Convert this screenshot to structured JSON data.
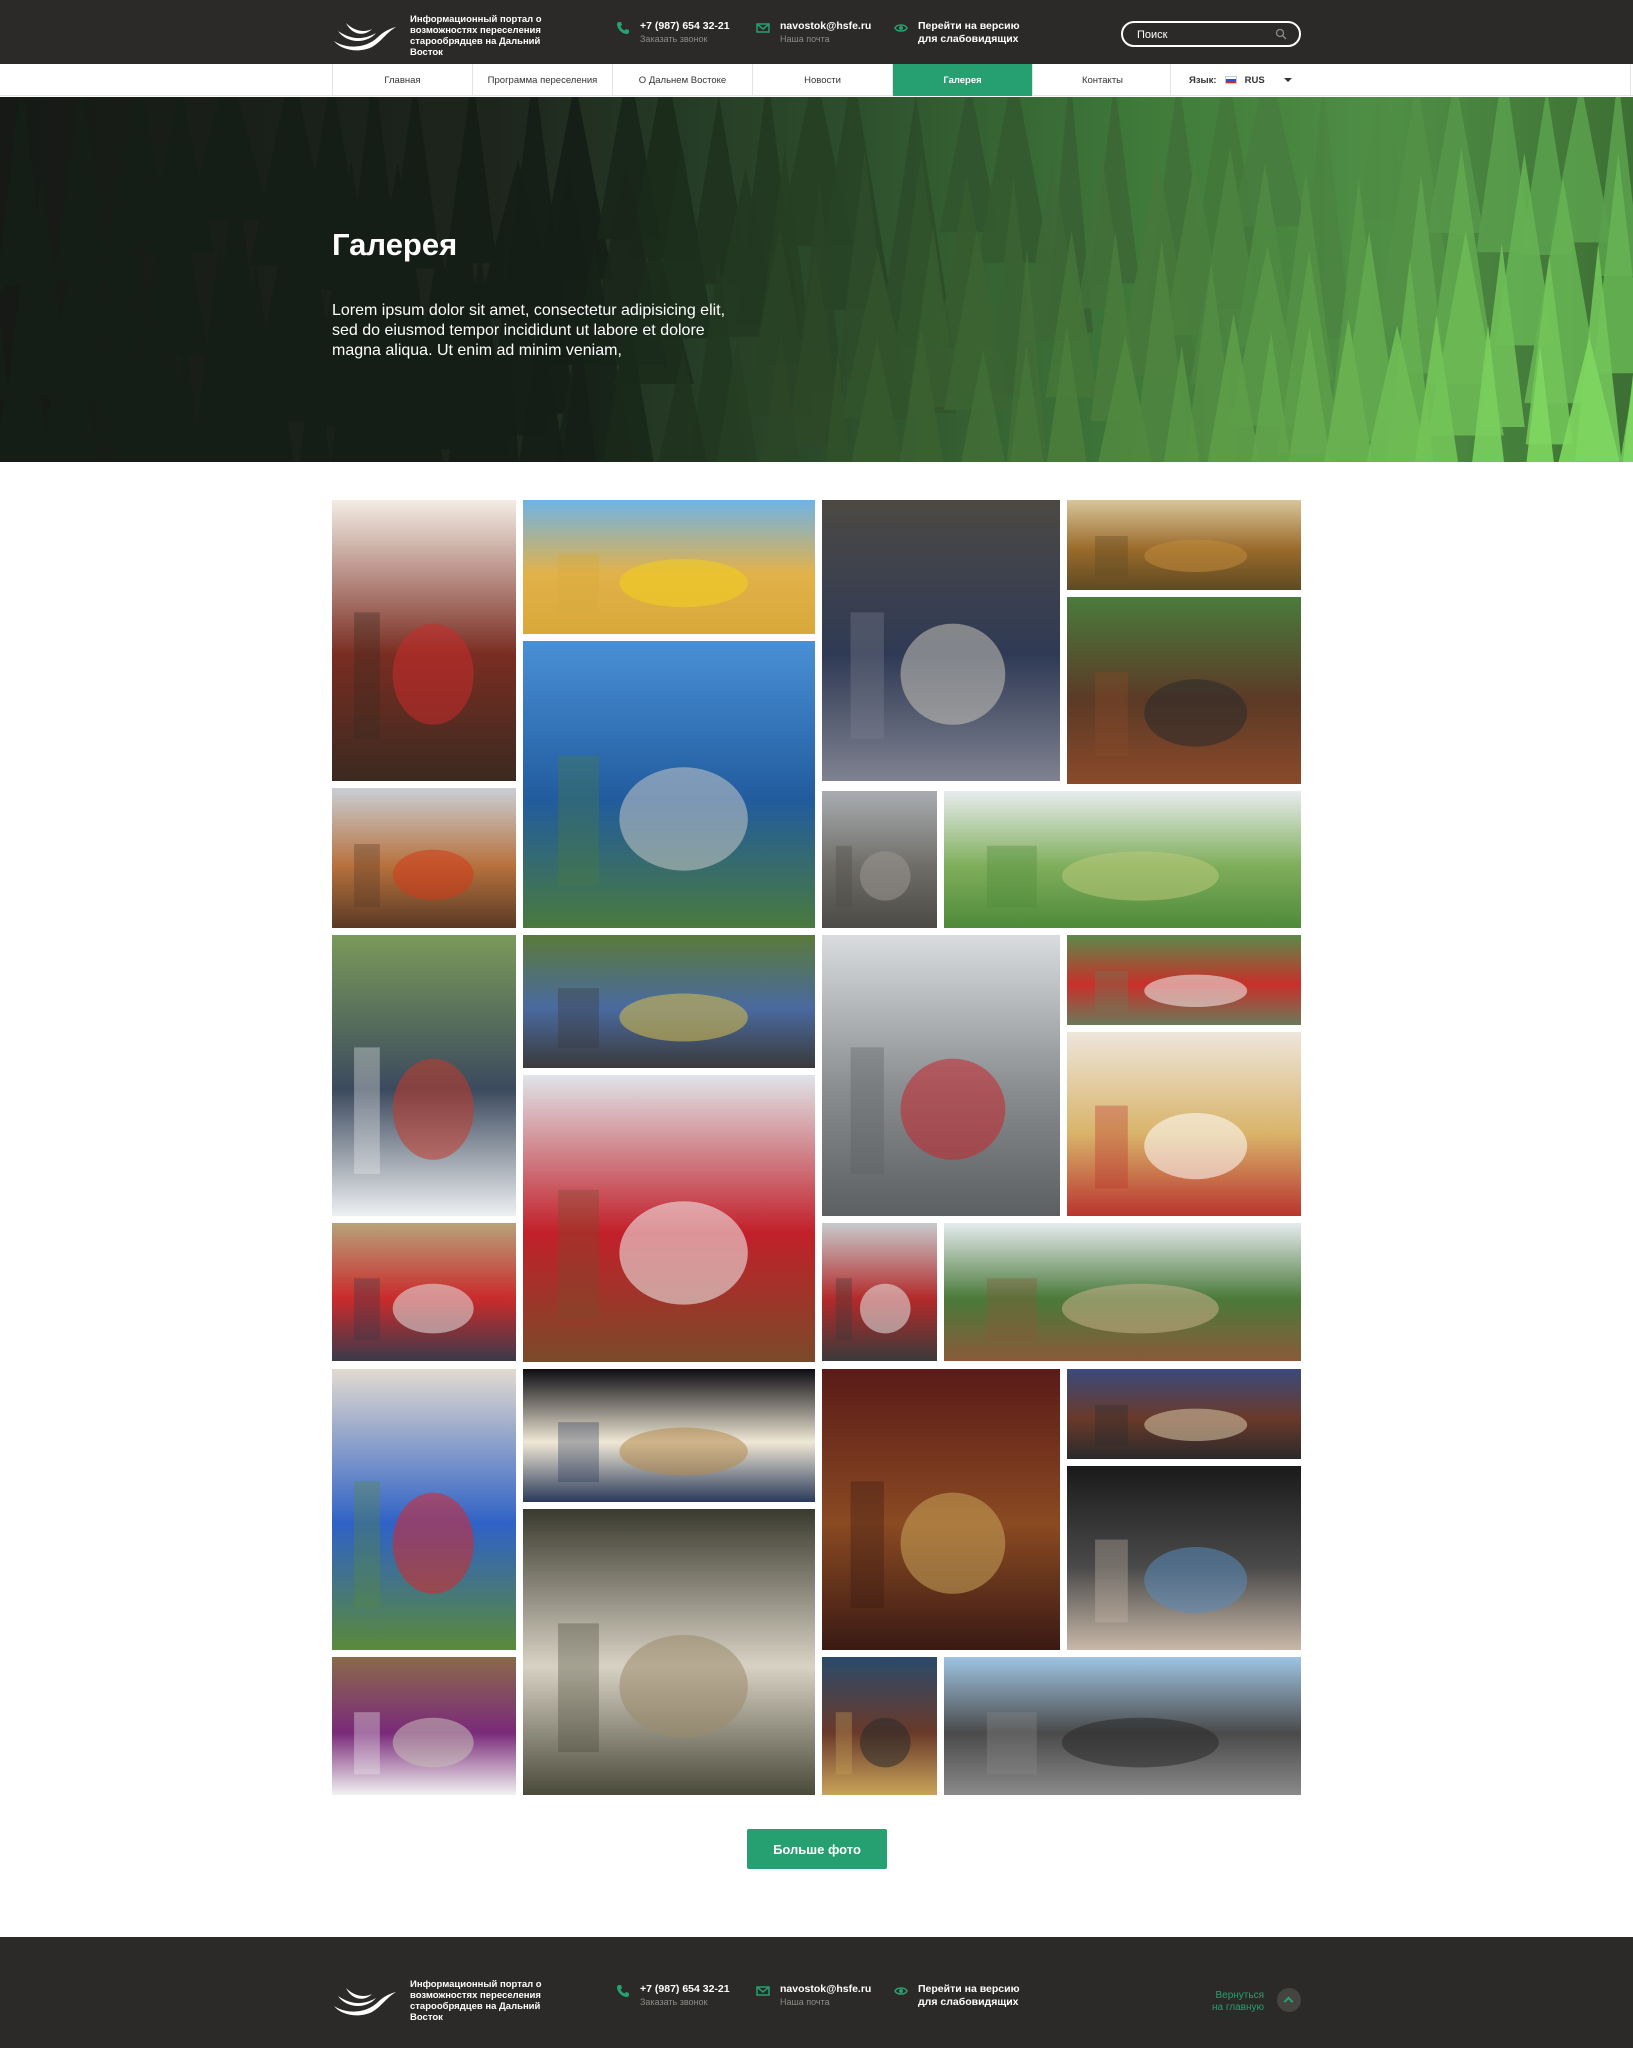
{
  "header": {
    "logo_text": "Информационный портал о возможностях переселения старообрядцев на Дальний Восток",
    "phone": "+7 (987) 654 32-21",
    "phone_sub": "Заказать звонок",
    "email": "navostok@hsfe.ru",
    "email_sub": "Наша почта",
    "accessibility": "Перейти на версию для слабовидящих",
    "search_placeholder": "Поиск"
  },
  "nav": {
    "items": [
      "Главная",
      "Программа переселения",
      "О Дальнем Востоке",
      "Новости",
      "Галерея",
      "Контакты"
    ],
    "active": "Галерея",
    "lang_label": "Язык:",
    "lang_value": "RUS"
  },
  "hero": {
    "title": "Галерея",
    "text": "Lorem ipsum dolor sit amet, consectetur adipisicing elit, sed do eiusmod tempor incididunt ut labore et dolore magna aliqua. Ut enim ad minim veniam,"
  },
  "gallery": {
    "more_button": "Больше фото",
    "photos": [
      "staircase-flag",
      "combine-harvester",
      "group-steps",
      "autumn-hills",
      "tractor-plough",
      "island-bridge",
      "harvester-field",
      "palace-building",
      "green-fields",
      "dinner-table",
      "cornfield-group",
      "parliament-building",
      "red-plane",
      "food-table",
      "family-red-dress",
      "red-car",
      "villa-house",
      "big-group",
      "night-palace",
      "flags-wall",
      "red-fireplace",
      "hall-two-men",
      "cockpit",
      "marble-fountain",
      "family-purple",
      "hall-small",
      "statue-city",
      "grain-silos"
    ]
  },
  "footer": {
    "logo_text": "Информационный портал о возможностях переселения старообрядцев на Дальний Восток",
    "phone": "+7 (987) 654 32-21",
    "phone_sub": "Заказать звонок",
    "email": "navostok@hsfe.ru",
    "email_sub": "Наша почта",
    "accessibility": "Перейти на версию для слабовидящих",
    "back_home": "Вернуться на главную"
  },
  "colors": {
    "accent": "#26a071",
    "header_bg": "#2b2a28",
    "text_muted": "#8d8c88"
  }
}
